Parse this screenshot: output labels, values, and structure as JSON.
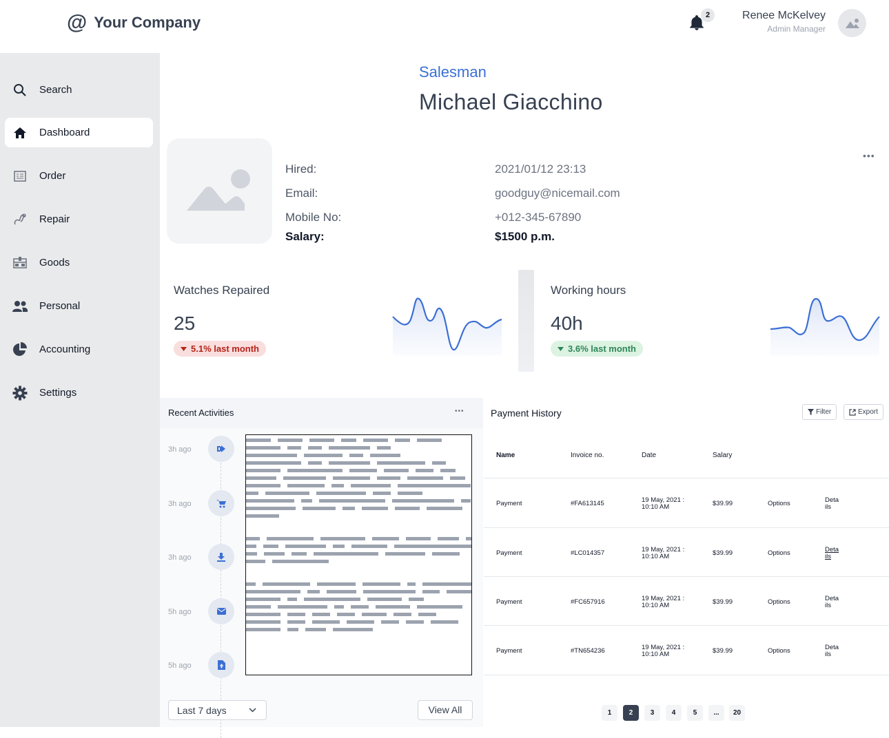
{
  "header": {
    "logo_symbol": "@",
    "company": "Your Company",
    "notifications": "2",
    "user_name": "Renee McKelvey",
    "user_role": "Admin Manager"
  },
  "sidebar": {
    "items": [
      {
        "label": "Search",
        "icon": "search-icon"
      },
      {
        "label": "Dashboard",
        "icon": "home-icon",
        "active": true
      },
      {
        "label": "Order",
        "icon": "order-icon"
      },
      {
        "label": "Repair",
        "icon": "repair-icon"
      },
      {
        "label": "Goods",
        "icon": "goods-icon"
      },
      {
        "label": "Personal",
        "icon": "people-icon"
      },
      {
        "label": "Accounting",
        "icon": "pie-chart-icon"
      },
      {
        "label": "Settings",
        "icon": "gear-icon"
      }
    ]
  },
  "profile": {
    "role": "Salesman",
    "name": "Michael Giacchino",
    "fields": [
      {
        "label": "Hired:",
        "value": "2021/01/12 23:13"
      },
      {
        "label": "Email:",
        "value": "goodguy@nicemail.com"
      },
      {
        "label": "Mobile No:",
        "value": "+012-345-67890"
      },
      {
        "label": "Salary:",
        "value": "$1500 p.m."
      }
    ],
    "more": "•••"
  },
  "stats": [
    {
      "title": "Watches Repaired",
      "value": "25",
      "change": "5.1% last month",
      "trend": "down",
      "status_color": "#b42318"
    },
    {
      "title": "Working hours",
      "value": "40h",
      "change": "3.6% last month",
      "trend": "down",
      "status_color": "#2f855a"
    }
  ],
  "activities": {
    "title": "Recent Activities",
    "more": "•••",
    "items": [
      {
        "time": "3h ago",
        "icon": "logout-icon"
      },
      {
        "time": "3h ago",
        "icon": "cart-icon"
      },
      {
        "time": "3h ago",
        "icon": "download-icon"
      },
      {
        "time": "5h ago",
        "icon": "mail-icon"
      },
      {
        "time": "5h ago",
        "icon": "upload-file-icon"
      }
    ],
    "range": "Last 7 days",
    "view_all": "View All"
  },
  "payments": {
    "title": "Payment History",
    "filter": "Filter",
    "export": "Export",
    "columns": [
      "Name",
      "Invoice no.",
      "Date",
      "Salary"
    ],
    "rows": [
      {
        "name": "Payment",
        "invoice": "#FA613145",
        "date": "19 May, 2021 : 10:10 AM",
        "salary": "$39.99",
        "options": "Options",
        "details": "Details"
      },
      {
        "name": "Payment",
        "invoice": "#LC014357",
        "date": "19 May, 2021 : 10:10 AM",
        "salary": "$39.99",
        "options": "Options",
        "details": "Details"
      },
      {
        "name": "Payment",
        "invoice": "#FC657916",
        "date": "19 May, 2021 : 10:10 AM",
        "salary": "$39.99",
        "options": "Options",
        "details": "Details"
      },
      {
        "name": "Payment",
        "invoice": "#TN654236",
        "date": "19 May, 2021 : 10:10 AM",
        "salary": "$39.99",
        "options": "Options",
        "details": "Details"
      }
    ],
    "pages": [
      "1",
      "2",
      "3",
      "4",
      "5",
      "...",
      "20"
    ],
    "current_page": "2"
  },
  "colors": {
    "accent": "#3b6fd4",
    "sidebar_bg": "#e9eaeb",
    "negative": "#b42318",
    "positive": "#2f855a"
  }
}
